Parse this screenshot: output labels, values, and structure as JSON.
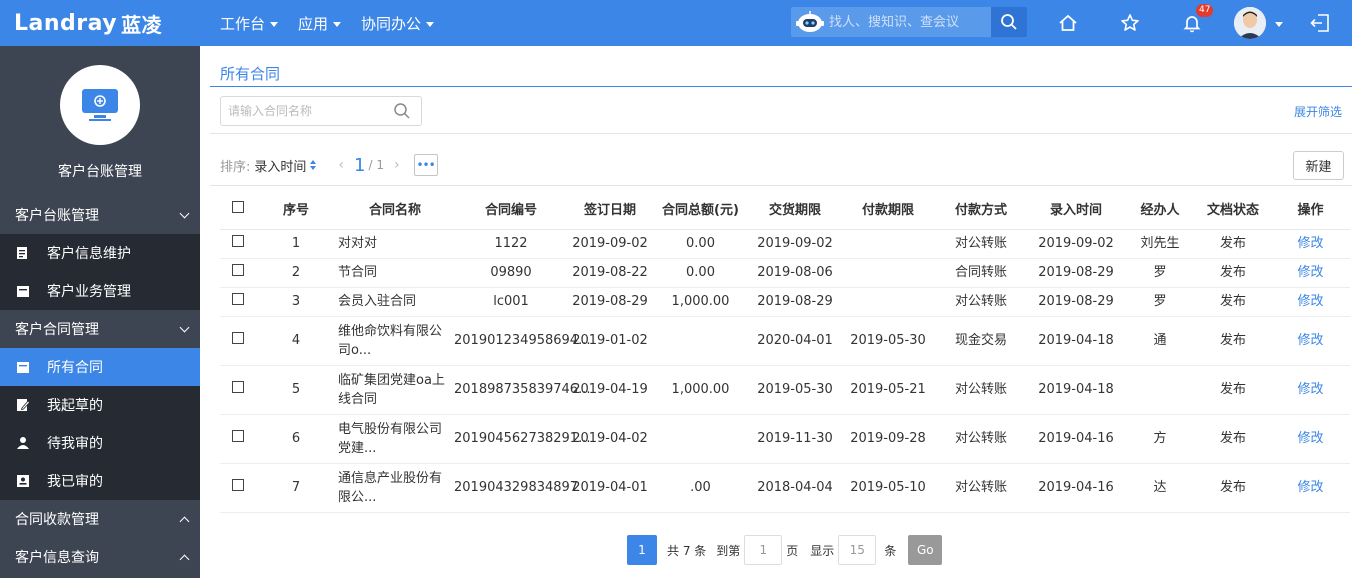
{
  "topbar": {
    "logo_en": "Landray",
    "logo_cn": "蓝凌",
    "nav": [
      "工作台",
      "应用",
      "协同办公"
    ],
    "search_placeholder": "找人、搜知识、查会议",
    "notification_count": "47",
    "brand_color": "#3b86e6"
  },
  "sidebar": {
    "title": "客户台账管理",
    "groups": [
      {
        "label": "客户台账管理",
        "expanded": true,
        "items": [
          "客户信息维护",
          "客户业务管理"
        ]
      },
      {
        "label": "客户合同管理",
        "expanded": true,
        "items": [
          "所有合同",
          "我起草的",
          "待我审的",
          "我已审的"
        ]
      },
      {
        "label": "合同收款管理",
        "expanded": false
      },
      {
        "label": "客户信息查询",
        "expanded": false
      }
    ],
    "active_item": "所有合同"
  },
  "main": {
    "title": "所有合同",
    "filter_placeholder": "请输入合同名称",
    "expand_filter": "展开筛选",
    "sort_label": "排序:",
    "sort_value": "录入时间",
    "page_current": "1",
    "page_total": "/ 1",
    "new_button": "新建",
    "columns": [
      "序号",
      "合同名称",
      "合同编号",
      "签订日期",
      "合同总额(元)",
      "交货期限",
      "付款期限",
      "付款方式",
      "录入时间",
      "经办人",
      "文档状态",
      "操作"
    ],
    "rows": [
      [
        "1",
        "对对对",
        "1122",
        "2019-09-02",
        "0.00",
        "2019-09-02",
        "",
        "对公转账",
        "2019-09-02",
        "刘先生",
        "发布",
        "修改"
      ],
      [
        "2",
        "节合同",
        "09890",
        "2019-08-22",
        "0.00",
        "2019-08-06",
        "",
        "合同转账",
        "2019-08-29",
        "罗",
        "发布",
        "修改"
      ],
      [
        "3",
        "会员入驻合同",
        "lc001",
        "2019-08-29",
        "1,000.00",
        "2019-08-29",
        "",
        "对公转账",
        "2019-08-29",
        "罗",
        "发布",
        "修改"
      ],
      [
        "4",
        "维他命饮料有限公司o...",
        "201901234958694...",
        "2019-01-02",
        "",
        "2020-04-01",
        "2019-05-30",
        "现金交易",
        "2019-04-18",
        "通",
        "发布",
        "修改"
      ],
      [
        "5",
        "临矿集团党建oa上线合同",
        "201898735839746...",
        "2019-04-19",
        "1,000.00",
        "2019-05-30",
        "2019-05-21",
        "对公转账",
        "2019-04-18",
        "",
        "发布",
        "修改"
      ],
      [
        "6",
        "电气股份有限公司党建...",
        "201904562738291...",
        "2019-04-02",
        "",
        "2019-11-30",
        "2019-09-28",
        "对公转账",
        "2019-04-16",
        "方",
        "发布",
        "修改"
      ],
      [
        "7",
        "通信息产业股份有限公...",
        "201904329834897",
        "2019-04-01",
        ".00",
        "2018-04-04",
        "2019-05-10",
        "对公转账",
        "2019-04-16",
        "达",
        "发布",
        "修改"
      ]
    ]
  },
  "pager": {
    "current": "1",
    "total_text": "共 7 条",
    "goto_label": "到第",
    "goto_value": "1",
    "page_unit": "页",
    "show_label": "显示",
    "page_size": "15",
    "size_unit": "条",
    "go": "Go"
  }
}
